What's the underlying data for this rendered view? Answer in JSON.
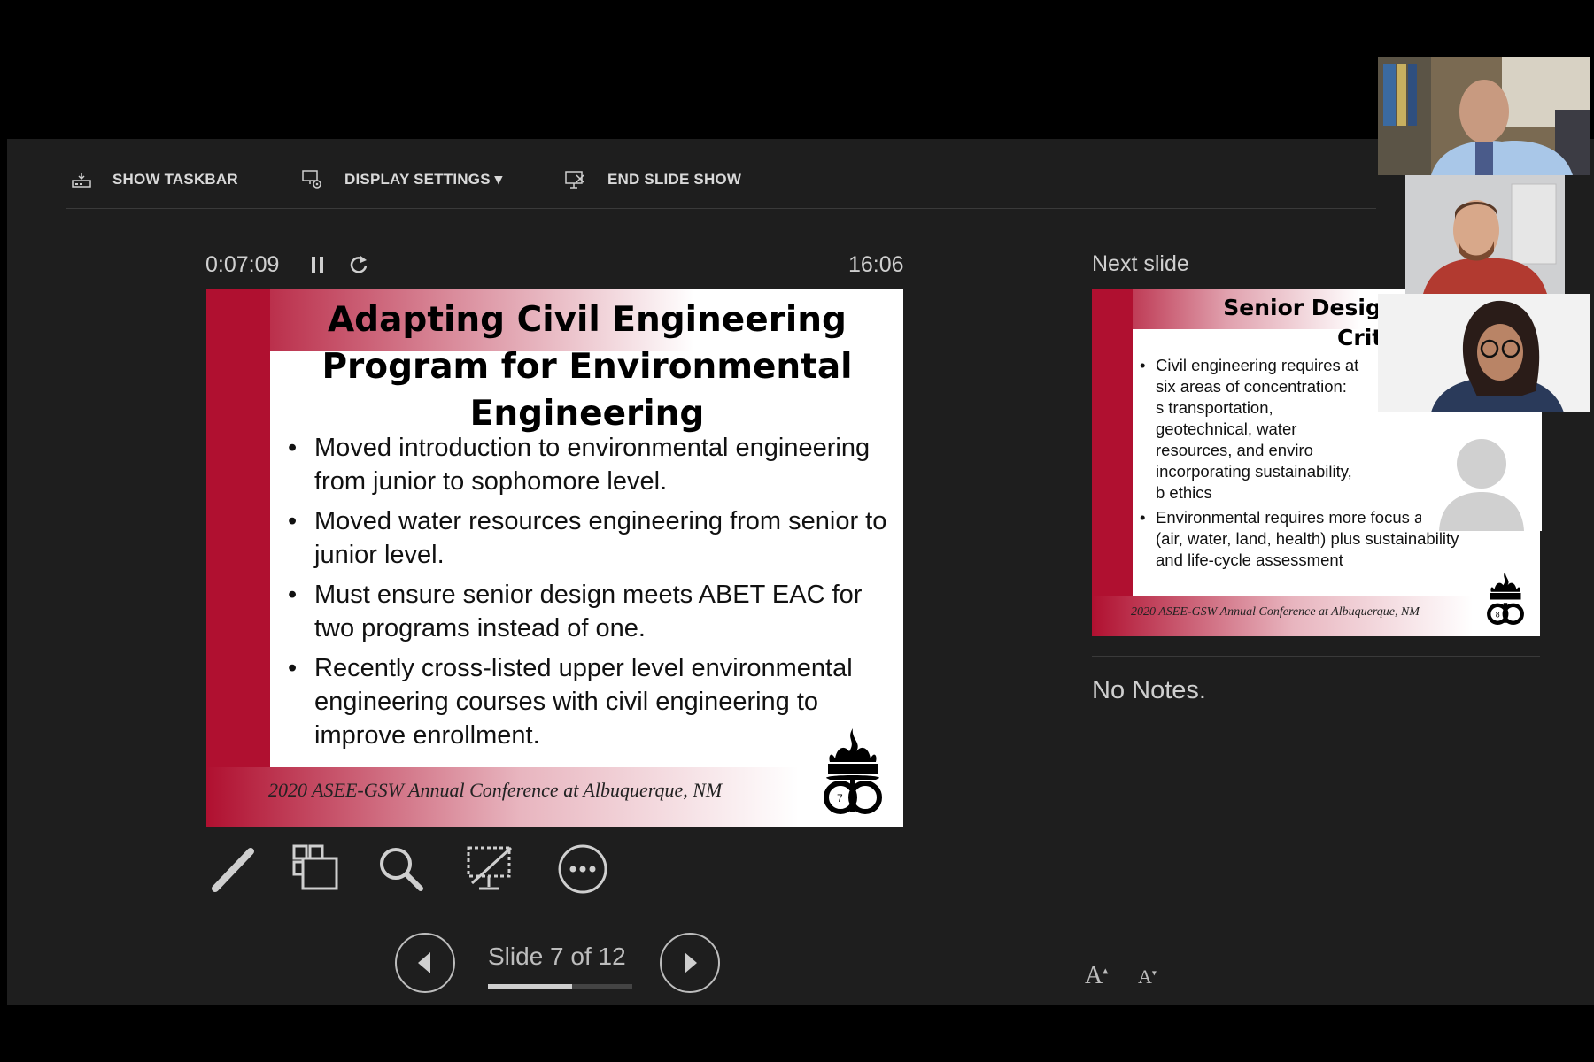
{
  "toolbar": {
    "show_taskbar": "SHOW TASKBAR",
    "display_settings": "DISPLAY SETTINGS ▾",
    "end_slide_show": "END SLIDE SHOW"
  },
  "timer": {
    "elapsed": "0:07:09",
    "clock": "16:06"
  },
  "current_slide": {
    "title": "Adapting Civil Engineering Program for Environmental Engineering",
    "bullets": [
      "Moved introduction to environmental engineering from junior to sophomore level.",
      "Moved water resources engineering from senior to junior level.",
      "Must ensure senior design meets ABET EAC for two programs instead of one.",
      "Recently cross-listed upper level environmental engineering courses with civil engineering to improve enrollment."
    ],
    "footer": "2020 ASEE-GSW Annual Conference at Albuquerque, NM",
    "page_number": "7"
  },
  "navigation": {
    "slide_count": "Slide 7 of 12",
    "progress": 0.583
  },
  "next_slide": {
    "label": "Next slide",
    "title_line1": "Senior Design AB",
    "title_line2": "Criteria",
    "bullets": [
      "Civil engineering requires at six areas of concentration: s transportation, geotechnical, water resources, and enviro incorporating sustainability, b ethics",
      "Environmental requires more focus area (air, water, land, health) plus sustainability and life-cycle assessment"
    ],
    "footer": "2020 ASEE-GSW Annual Conference at Albuquerque, NM",
    "page_number": "8"
  },
  "notes": "No Notes.",
  "font_controls": {
    "increase": "A",
    "decrease": "A"
  },
  "participants": [
    {
      "role": "video-tile-1"
    },
    {
      "role": "video-tile-2"
    },
    {
      "role": "video-tile-3"
    },
    {
      "role": "video-tile-4",
      "camera": "off"
    }
  ],
  "colors": {
    "accent": "#b01030",
    "background": "#1e1e1e"
  }
}
